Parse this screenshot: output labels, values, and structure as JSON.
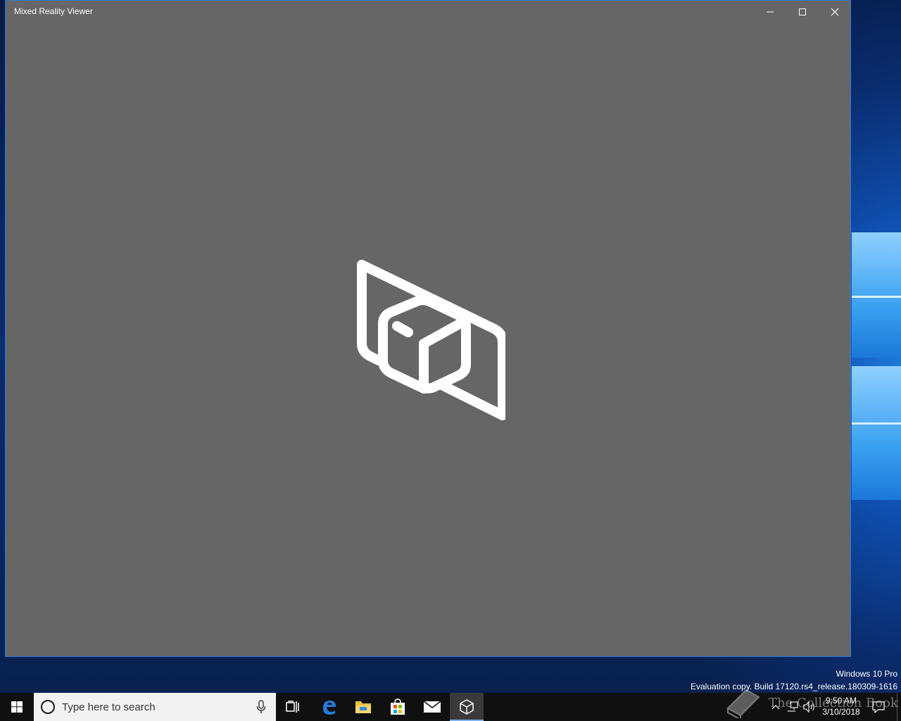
{
  "window": {
    "title": "Mixed Reality Viewer",
    "minimize_icon": "minimize-icon",
    "maximize_icon": "maximize-icon",
    "close_icon": "close-icon",
    "app_logo_icon": "mixed-reality-viewer-logo",
    "background_color": "#666666"
  },
  "watermark": {
    "edition": "Windows 10 Pro",
    "build": "Evaluation copy. Build 17120.rs4_release.180309-1616"
  },
  "taskbar": {
    "search_placeholder": "Type here to search",
    "pinned": [
      {
        "name": "Task View",
        "icon": "task-view-icon"
      },
      {
        "name": "Microsoft Edge",
        "icon": "edge-icon"
      },
      {
        "name": "File Explorer",
        "icon": "folder-icon"
      },
      {
        "name": "Microsoft Store",
        "icon": "store-icon"
      },
      {
        "name": "Mail",
        "icon": "mail-icon"
      },
      {
        "name": "Mixed Reality Viewer",
        "icon": "cube-icon",
        "active": true
      }
    ],
    "clock": {
      "time": "9:50 AM",
      "date": "3/10/2018"
    }
  },
  "overlay_watermark": {
    "text": "The Collection Book"
  }
}
